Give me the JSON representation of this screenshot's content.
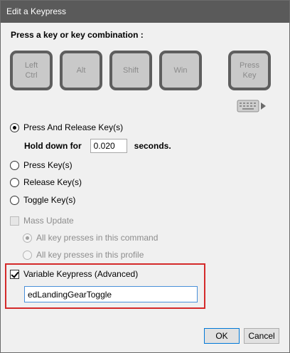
{
  "window": {
    "title": "Edit a Keypress"
  },
  "heading": "Press a key or key combination :",
  "keys": [
    {
      "label": "Left\nCtrl"
    },
    {
      "label": "Alt"
    },
    {
      "label": "Shift"
    },
    {
      "label": "Win"
    },
    {
      "label": "Press\nKey"
    }
  ],
  "options": {
    "press_release": "Press And Release Key(s)",
    "hold_label": "Hold down for",
    "hold_value": "0.020",
    "hold_unit": "seconds.",
    "press": "Press Key(s)",
    "release": "Release Key(s)",
    "toggle": "Toggle Key(s)"
  },
  "mass_update": {
    "label": "Mass Update",
    "all_command": "All key presses in this command",
    "all_profile": "All key presses in this profile"
  },
  "variable": {
    "label": "Variable Keypress (Advanced)",
    "value": "edLandingGearToggle"
  },
  "buttons": {
    "ok": "OK",
    "cancel": "Cancel"
  },
  "colors": {
    "titlebar": "#5a5a5a",
    "highlight": "#d42a2a",
    "focus": "#4a90d9"
  }
}
